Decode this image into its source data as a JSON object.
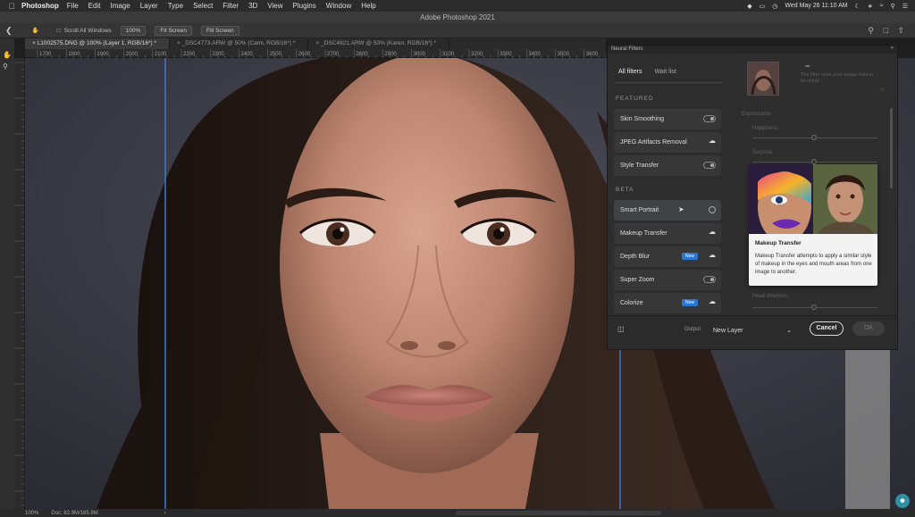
{
  "menubar": {
    "app_name": "Photoshop",
    "items": [
      "File",
      "Edit",
      "Image",
      "Layer",
      "Type",
      "Select",
      "Filter",
      "3D",
      "View",
      "Plugins",
      "Window",
      "Help"
    ],
    "datetime": "Wed May 26  11:10 AM"
  },
  "window": {
    "title": "Adobe Photoshop 2021"
  },
  "options": {
    "scroll_all_windows": "Scroll All Windows",
    "zoom_100": "100%",
    "fit_screen": "Fit Screen",
    "fill_screen": "Fill Screen"
  },
  "tabs": [
    {
      "label": "L1002575.DNG @ 100% (Layer 1, RGB/16*) *"
    },
    {
      "label": "_DSC4773.ARW @ 50% (Cami, RGB/16*) *"
    },
    {
      "label": "_DSC4921.ARW @ 50% (Karen, RGB/16*) *"
    }
  ],
  "ruler": {
    "labels": [
      "1700",
      "1800",
      "1900",
      "2000",
      "2100",
      "2200",
      "2300",
      "2400",
      "2500",
      "2600",
      "2700",
      "2800",
      "2900",
      "3000",
      "3100",
      "3200",
      "3300",
      "3400",
      "3500",
      "3600"
    ]
  },
  "status": {
    "zoom": "100%",
    "doc": "Doc: 82.9M/165.9M"
  },
  "neural_filters": {
    "panel_title": "Neural Filters",
    "tab_all": "All filters",
    "tab_wait": "Wait list",
    "featured_heading": "FEATURED",
    "beta_heading": "BETA",
    "featured": [
      {
        "label": "Skin Smoothing",
        "control": "toggle"
      },
      {
        "label": "JPEG Artifacts Removal",
        "control": "cloud"
      },
      {
        "label": "Style Transfer",
        "control": "toggle"
      }
    ],
    "beta": [
      {
        "label": "Smart Portrait",
        "control": "radio",
        "badge": ""
      },
      {
        "label": "Makeup Transfer",
        "control": "cloud",
        "badge": ""
      },
      {
        "label": "Depth Blur",
        "control": "cloud",
        "badge": "New"
      },
      {
        "label": "Super Zoom",
        "control": "toggle",
        "badge": ""
      },
      {
        "label": "Colorize",
        "control": "cloud",
        "badge": "New"
      }
    ],
    "right": {
      "ref_text": "The filter uses your image data in its cloud",
      "label_1": "Expressions",
      "label_2": "Happiness",
      "label_3": "Surprise",
      "label_4": "Head direction"
    },
    "tooltip": {
      "title": "Makeup Transfer",
      "desc": "Makeup Transfer attempts to apply a similar style of makeup in the eyes and mouth areas from one image to another."
    },
    "output_label": "Output",
    "output_value": "New Layer",
    "cancel": "Cancel",
    "ok": "OK"
  }
}
